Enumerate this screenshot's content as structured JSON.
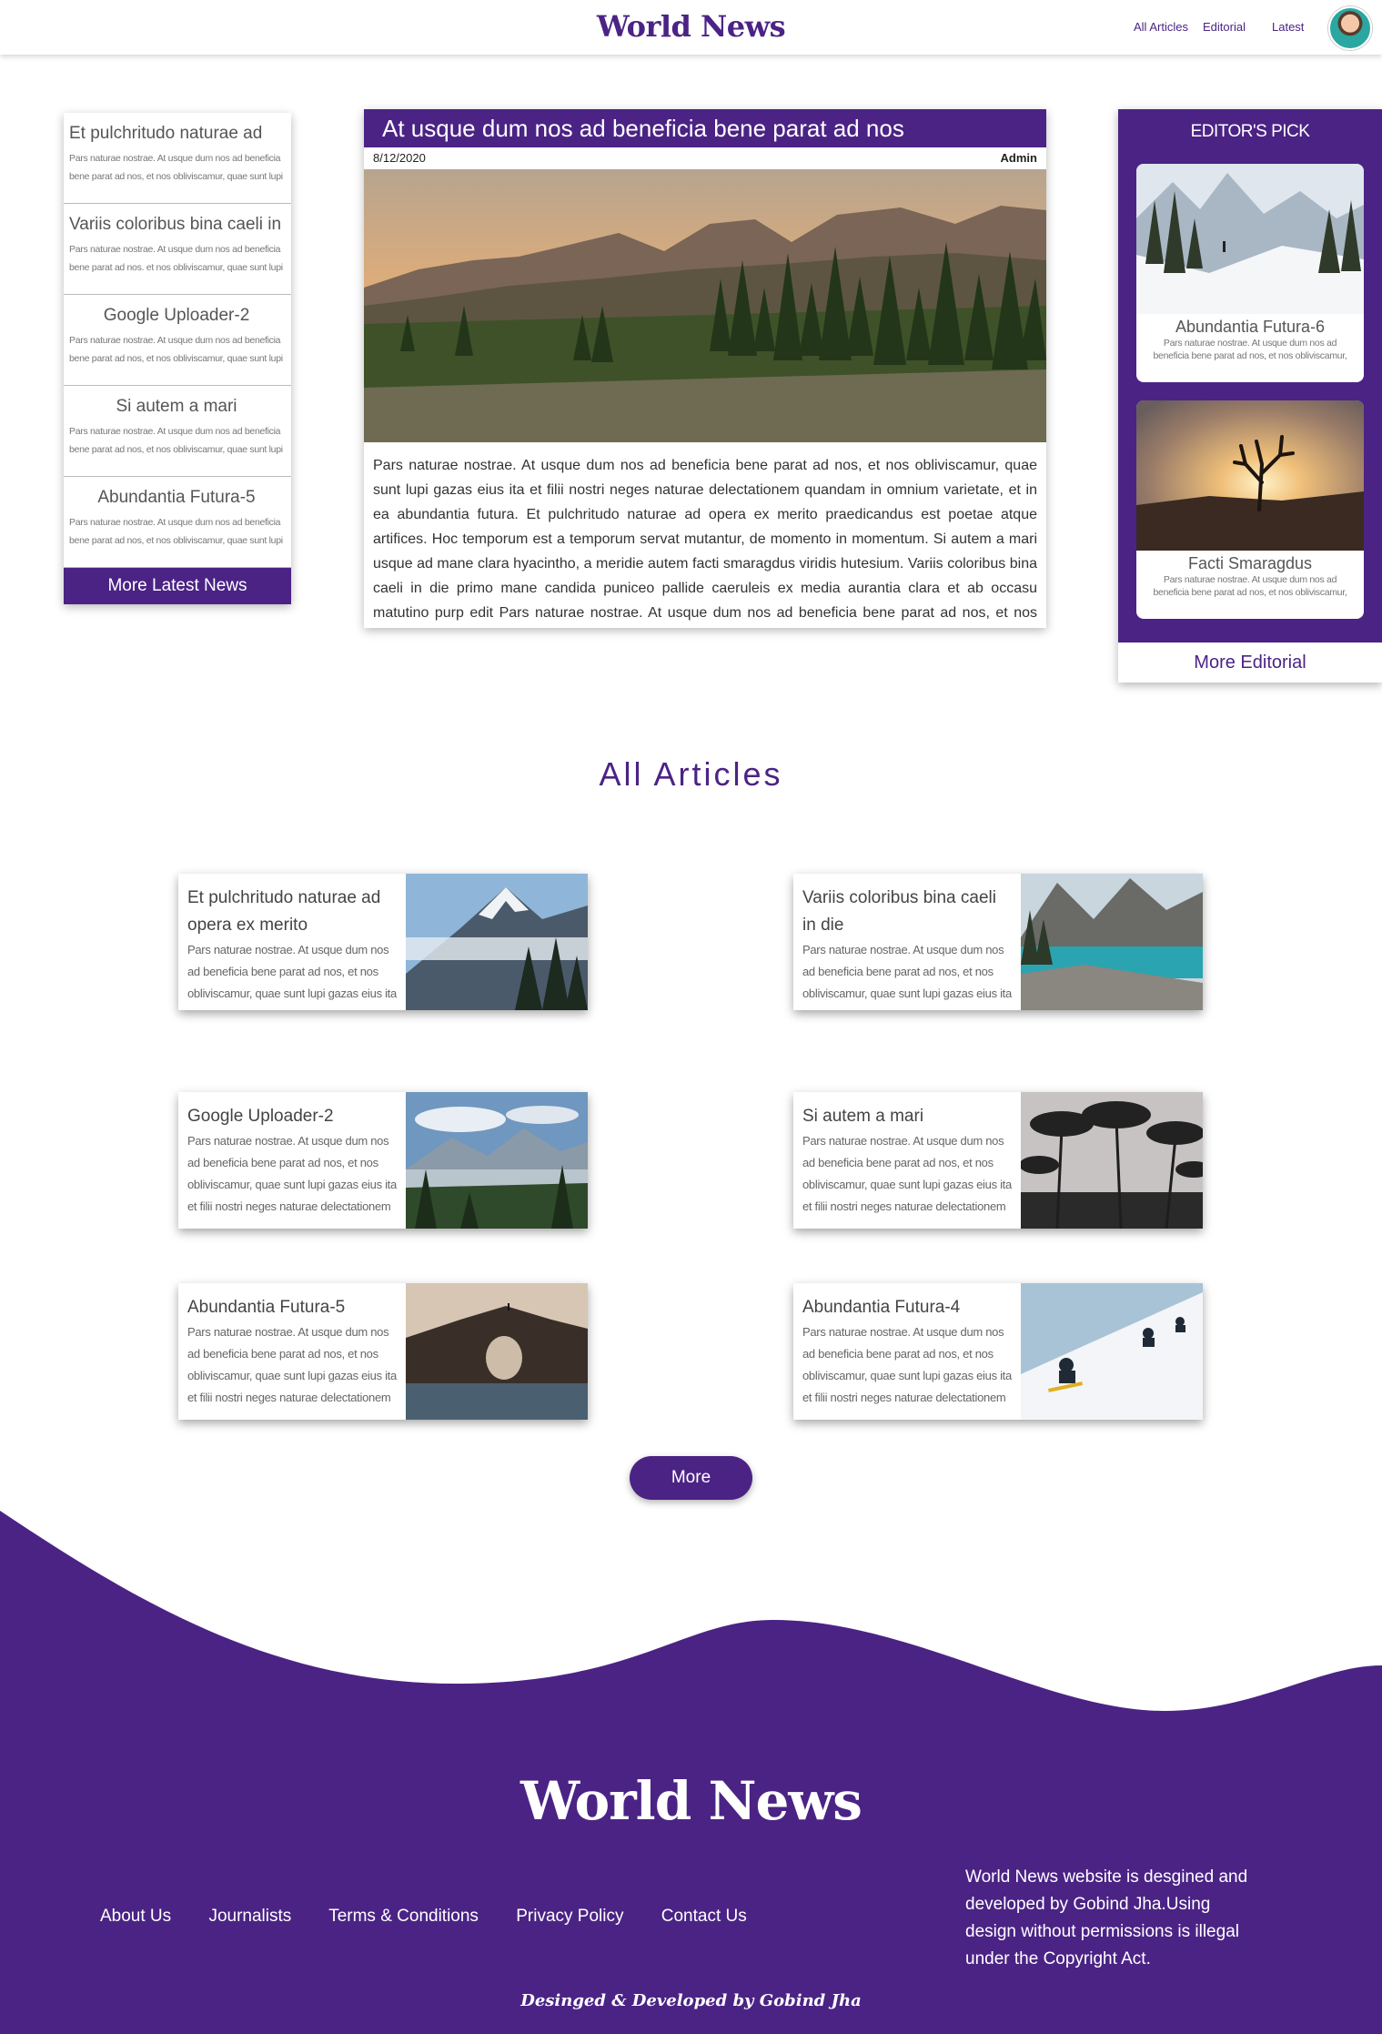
{
  "header": {
    "logo": "World News",
    "nav": [
      "All Articles",
      "Editorial",
      "Latest"
    ]
  },
  "latest": {
    "items": [
      {
        "title": "Et pulchritudo naturae ad",
        "excerpt": "Pars naturae nostrae. At usque dum nos ad beneficia bene parat ad nos, et nos obliviscamur, quae sunt lupi"
      },
      {
        "title": "Variis coloribus bina caeli in",
        "excerpt": "Pars naturae nostrae. At usque dum nos ad beneficia bene parat ad nos. et nos obliviscamur, quae sunt lupi"
      },
      {
        "title": "Google Uploader-2",
        "excerpt": "Pars naturae nostrae. At usque dum nos ad beneficia bene parat ad nos, et nos obliviscamur, quae sunt lupi"
      },
      {
        "title": "Si autem a mari",
        "excerpt": "Pars naturae nostrae. At usque dum nos ad beneficia bene parat ad nos, et nos obliviscamur, quae sunt lupi"
      },
      {
        "title": "Abundantia Futura-5",
        "excerpt": "Pars naturae nostrae. At usque dum nos ad beneficia bene parat ad nos, et nos obliviscamur, quae sunt lupi"
      }
    ],
    "more_label": "More Latest News"
  },
  "featured": {
    "title": "At usque dum nos ad beneficia bene parat ad nos",
    "date": "8/12/2020",
    "author": "Admin",
    "body": "Pars naturae nostrae. At usque dum nos ad beneficia bene parat ad nos, et nos obliviscamur, quae sunt lupi gazas eius ita et filii nostri neges naturae delectationem quandam in omnium varietate, et in ea abundantia futura. Et pulchritudo naturae ad opera ex merito praedicandus est poetae atque artifices. Hoc temporum est a temporum servat mutantur, de momento in momentum. Si autem a mari usque ad mane clara hyacintho, a meridie autem facti smaragdus viridis hutesium. Variis coloribus bina caeli in die primo mane candida puniceo pallide caeruleis ex media aurantia clara et ab occasu matutino purp edit Pars naturae nostrae. At usque dum nos ad beneficia bene parat ad nos, et nos obliviscamur, quae sunt lupi gazas eius ita et filii nostri neges"
  },
  "editors_pick": {
    "title": "EDITOR'S PICK",
    "cards": [
      {
        "title": "Abundantia Futura-6",
        "excerpt": "Pars naturae nostrae. At usque dum nos ad beneficia bene parat ad nos, et nos obliviscamur,"
      },
      {
        "title": "Facti Smaragdus",
        "excerpt": "Pars naturae nostrae. At usque dum nos ad beneficia bene parat ad nos, et nos obliviscamur,"
      }
    ],
    "more_label": "More Editorial"
  },
  "articles": {
    "title": "All Articles",
    "items": [
      {
        "title": "Et pulchritudo naturae ad opera ex merito",
        "excerpt": "Pars naturae nostrae. At usque dum nos ad beneficia bene parat ad nos, et nos obliviscamur, quae sunt lupi gazas eius ita et filii nostri neges naturae delectationem"
      },
      {
        "title": "Variis coloribus bina caeli in die",
        "excerpt": "Pars naturae nostrae. At usque dum nos ad beneficia bene parat ad nos, et nos obliviscamur, quae sunt lupi gazas eius ita et filii nostri neges naturae delectationem"
      },
      {
        "title": "Google Uploader-2",
        "excerpt": "Pars naturae nostrae. At usque dum nos ad beneficia bene parat ad nos, et nos obliviscamur, quae sunt lupi gazas eius ita et filii nostri neges naturae delectationem"
      },
      {
        "title": "Si autem a mari",
        "excerpt": "Pars naturae nostrae. At usque dum nos ad beneficia bene parat ad nos, et nos obliviscamur, quae sunt lupi gazas eius ita et filii nostri neges naturae delectationem"
      },
      {
        "title": "Abundantia Futura-5",
        "excerpt": "Pars naturae nostrae. At usque dum nos ad beneficia bene parat ad nos, et nos obliviscamur, quae sunt lupi gazas eius ita et filii nostri neges naturae delectationem"
      },
      {
        "title": "Abundantia Futura-4",
        "excerpt": "Pars naturae nostrae. At usque dum nos ad beneficia bene parat ad nos, et nos obliviscamur, quae sunt lupi gazas eius ita et filii nostri neges naturae delectationem"
      }
    ],
    "more_label": "More"
  },
  "footer": {
    "logo": "World News",
    "links": [
      "About Us",
      "Journalists",
      "Terms & Conditions",
      "Privacy Policy",
      "Contact Us"
    ],
    "about": "World News website is desgined and developed by Gobind Jha.Using design without permissions is illegal under the Copyright Act.",
    "credit": "Desinged & Developed by Gobind Jha"
  },
  "colors": {
    "brand": "#4b2385",
    "background": "#ffffff"
  }
}
